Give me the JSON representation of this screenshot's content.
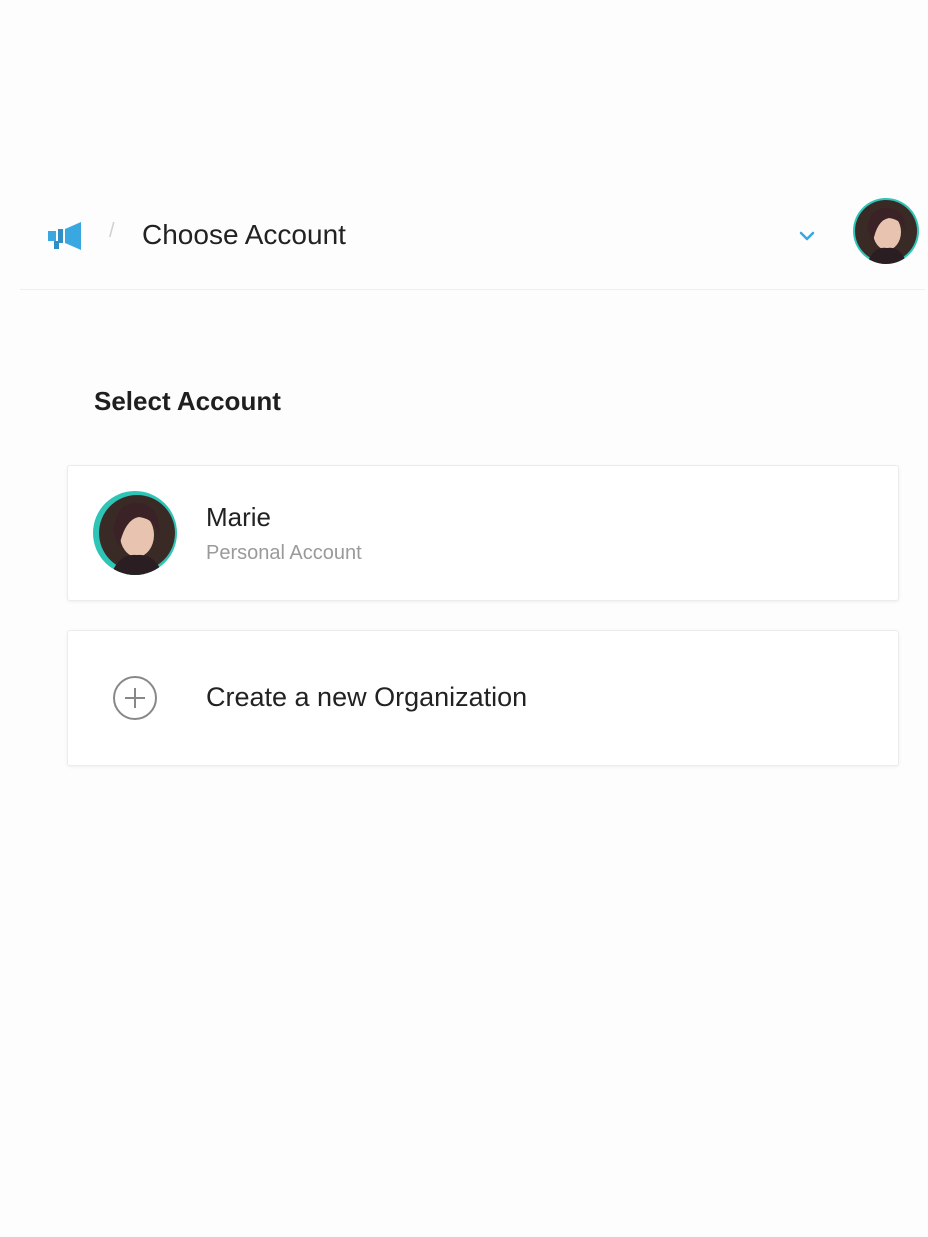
{
  "header": {
    "separator": "/",
    "title": "Choose Account",
    "logo_icon": "megaphone-icon",
    "dropdown_icon": "chevron-down-icon",
    "accent_color": "#3aa8e0"
  },
  "main": {
    "section_title": "Select Account",
    "accounts": [
      {
        "name": "Marie",
        "type": "Personal Account"
      }
    ],
    "create": {
      "label": "Create a new Organization",
      "icon": "plus-circle-icon"
    }
  }
}
